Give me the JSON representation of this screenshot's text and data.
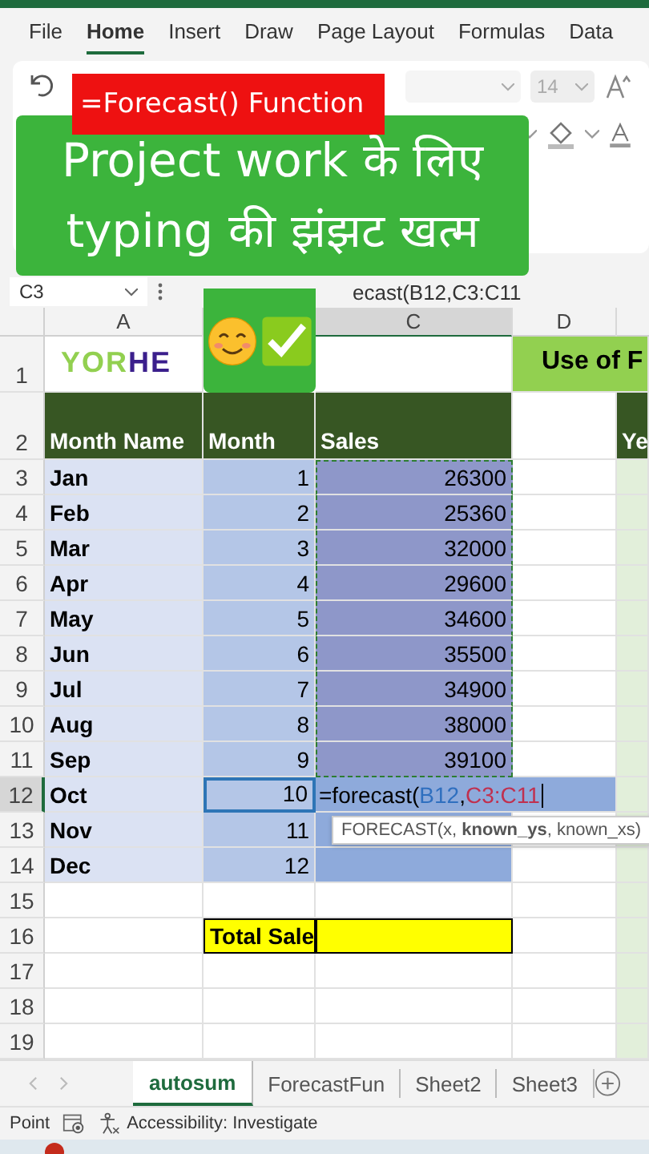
{
  "ribbon": {
    "tabs": [
      {
        "label": "File",
        "selected": false
      },
      {
        "label": "Home",
        "selected": true
      },
      {
        "label": "Insert",
        "selected": false
      },
      {
        "label": "Draw",
        "selected": false
      },
      {
        "label": "Page Layout",
        "selected": false
      },
      {
        "label": "Formulas",
        "selected": false
      },
      {
        "label": "Data",
        "selected": false
      }
    ],
    "font_size": "14"
  },
  "overlays": {
    "caption": "=Forecast() Function",
    "headline": [
      "Project work के लिए",
      "typing की झंझट खत्म"
    ]
  },
  "formula_bar": {
    "name_box": "C3",
    "formula": "ecast(B12,C3:C11"
  },
  "sheet": {
    "columns": [
      {
        "text": "A",
        "selected": false
      },
      {
        "text": "C",
        "selected": true
      },
      {
        "text": "D",
        "selected": false
      }
    ],
    "rows": [
      {
        "num": "1",
        "in_range": false,
        "active": false,
        "cells": [
          {
            "kind": "logo",
            "color": "#ffffff",
            "parts": [
              {
                "text": "YOR",
                "color": "#92d050"
              },
              {
                "text": "HE",
                "color": "#3b1f8c"
              }
            ]
          },
          {
            "kind": "empty",
            "color": "#ffffff"
          },
          {
            "kind": "title",
            "color": "#92d050",
            "text": "Use of F"
          }
        ]
      },
      {
        "num": "2",
        "in_range": false,
        "active": false,
        "cells": [
          {
            "kind": "header",
            "color": "#375623",
            "text": "Month Name"
          },
          {
            "kind": "header",
            "color": "#375623",
            "text": "Month"
          },
          {
            "kind": "header",
            "color": "#375623",
            "text": "Sales"
          },
          {
            "kind": "empty",
            "color": "#ffffff"
          },
          {
            "kind": "header",
            "color": "#375623",
            "text": "Ye"
          }
        ]
      },
      {
        "num": "3",
        "in_range": true,
        "active": false,
        "cells": [
          {
            "kind": "label",
            "color": "#dbe2f3",
            "text": "Jan"
          },
          {
            "kind": "number",
            "color": "#b4c6e7",
            "text": "1"
          },
          {
            "kind": "number",
            "color": "#8e97c9",
            "text": "26300"
          },
          {
            "kind": "empty",
            "color": "#ffffff"
          },
          {
            "kind": "empty",
            "color": "#e2efda"
          }
        ]
      },
      {
        "num": "4",
        "in_range": true,
        "active": false,
        "cells": [
          {
            "kind": "label",
            "color": "#dbe2f3",
            "text": "Feb"
          },
          {
            "kind": "number",
            "color": "#b4c6e7",
            "text": "2"
          },
          {
            "kind": "number",
            "color": "#8e97c9",
            "text": "25360"
          },
          {
            "kind": "empty",
            "color": "#ffffff"
          },
          {
            "kind": "empty",
            "color": "#e2efda"
          }
        ]
      },
      {
        "num": "5",
        "in_range": true,
        "active": false,
        "cells": [
          {
            "kind": "label",
            "color": "#dbe2f3",
            "text": "Mar"
          },
          {
            "kind": "number",
            "color": "#b4c6e7",
            "text": "3"
          },
          {
            "kind": "number",
            "color": "#8e97c9",
            "text": "32000"
          },
          {
            "kind": "empty",
            "color": "#ffffff"
          },
          {
            "kind": "empty",
            "color": "#e2efda"
          }
        ]
      },
      {
        "num": "6",
        "in_range": true,
        "active": false,
        "cells": [
          {
            "kind": "label",
            "color": "#dbe2f3",
            "text": "Apr"
          },
          {
            "kind": "number",
            "color": "#b4c6e7",
            "text": "4"
          },
          {
            "kind": "number",
            "color": "#8e97c9",
            "text": "29600"
          },
          {
            "kind": "empty",
            "color": "#ffffff"
          },
          {
            "kind": "empty",
            "color": "#e2efda"
          }
        ]
      },
      {
        "num": "7",
        "in_range": true,
        "active": false,
        "cells": [
          {
            "kind": "label",
            "color": "#dbe2f3",
            "text": "May"
          },
          {
            "kind": "number",
            "color": "#b4c6e7",
            "text": "5"
          },
          {
            "kind": "number",
            "color": "#8e97c9",
            "text": "34600"
          },
          {
            "kind": "empty",
            "color": "#ffffff"
          },
          {
            "kind": "empty",
            "color": "#e2efda"
          }
        ]
      },
      {
        "num": "8",
        "in_range": true,
        "active": false,
        "cells": [
          {
            "kind": "label",
            "color": "#dbe2f3",
            "text": "Jun"
          },
          {
            "kind": "number",
            "color": "#b4c6e7",
            "text": "6"
          },
          {
            "kind": "number",
            "color": "#8e97c9",
            "text": "35500"
          },
          {
            "kind": "empty",
            "color": "#ffffff"
          },
          {
            "kind": "empty",
            "color": "#e2efda"
          }
        ]
      },
      {
        "num": "9",
        "in_range": true,
        "active": false,
        "cells": [
          {
            "kind": "label",
            "color": "#dbe2f3",
            "text": "Jul"
          },
          {
            "kind": "number",
            "color": "#b4c6e7",
            "text": "7"
          },
          {
            "kind": "number",
            "color": "#8e97c9",
            "text": "34900"
          },
          {
            "kind": "empty",
            "color": "#ffffff"
          },
          {
            "kind": "empty",
            "color": "#e2efda"
          }
        ]
      },
      {
        "num": "10",
        "in_range": true,
        "active": false,
        "cells": [
          {
            "kind": "label",
            "color": "#dbe2f3",
            "text": "Aug"
          },
          {
            "kind": "number",
            "color": "#b4c6e7",
            "text": "8"
          },
          {
            "kind": "number",
            "color": "#8e97c9",
            "text": "38000"
          },
          {
            "kind": "empty",
            "color": "#ffffff"
          },
          {
            "kind": "empty",
            "color": "#e2efda"
          }
        ]
      },
      {
        "num": "11",
        "in_range": true,
        "active": false,
        "cells": [
          {
            "kind": "label",
            "color": "#dbe2f3",
            "text": "Sep"
          },
          {
            "kind": "number",
            "color": "#b4c6e7",
            "text": "9"
          },
          {
            "kind": "number",
            "color": "#8e97c9",
            "text": "39100"
          },
          {
            "kind": "empty",
            "color": "#ffffff"
          },
          {
            "kind": "empty",
            "color": "#e2efda"
          }
        ]
      },
      {
        "num": "12",
        "in_range": false,
        "active": true,
        "cells": [
          {
            "kind": "label",
            "color": "#dbe2f3",
            "text": "Oct"
          },
          {
            "kind": "number",
            "color": "#b4c6e7",
            "text": "10"
          },
          {
            "kind": "formula",
            "color": "#8eaadb",
            "parts": [
              {
                "text": "=forecast(",
                "color": "#000000"
              },
              {
                "text": "B12",
                "color": "#2f6fbf"
              },
              {
                "text": ",",
                "color": "#000000"
              },
              {
                "text": "C3:C11",
                "color": "#c0304f"
              }
            ]
          },
          {
            "kind": "empty",
            "color": "#e2efda"
          }
        ]
      },
      {
        "num": "13",
        "in_range": false,
        "active": false,
        "cells": [
          {
            "kind": "label",
            "color": "#dbe2f3",
            "text": "Nov"
          },
          {
            "kind": "number",
            "color": "#b4c6e7",
            "text": "11"
          },
          {
            "kind": "empty",
            "color": "#8eaadb"
          },
          {
            "kind": "empty",
            "color": "#ffffff"
          },
          {
            "kind": "empty",
            "color": "#e2efda"
          }
        ]
      },
      {
        "num": "14",
        "in_range": false,
        "active": false,
        "cells": [
          {
            "kind": "label",
            "color": "#dbe2f3",
            "text": "Dec"
          },
          {
            "kind": "number",
            "color": "#b4c6e7",
            "text": "12"
          },
          {
            "kind": "empty",
            "color": "#8eaadb"
          },
          {
            "kind": "empty",
            "color": "#ffffff"
          },
          {
            "kind": "empty",
            "color": "#e2efda"
          }
        ]
      },
      {
        "num": "15",
        "in_range": false,
        "active": false,
        "cells": [
          {
            "kind": "empty",
            "color": "#ffffff"
          },
          {
            "kind": "empty",
            "color": "#ffffff"
          },
          {
            "kind": "empty",
            "color": "#ffffff"
          },
          {
            "kind": "empty",
            "color": "#ffffff"
          },
          {
            "kind": "empty",
            "color": "#e2efda"
          }
        ]
      },
      {
        "num": "16",
        "in_range": false,
        "active": false,
        "cells": [
          {
            "kind": "empty",
            "color": "#ffffff"
          },
          {
            "kind": "total",
            "color": "#ffff00",
            "text": "Total Sale"
          },
          {
            "kind": "total",
            "color": "#ffff00"
          },
          {
            "kind": "empty",
            "color": "#ffffff"
          },
          {
            "kind": "empty",
            "color": "#e2efda"
          }
        ]
      },
      {
        "num": "17",
        "in_range": false,
        "active": false,
        "cells": [
          {
            "kind": "empty",
            "color": "#ffffff"
          },
          {
            "kind": "empty",
            "color": "#ffffff"
          },
          {
            "kind": "empty",
            "color": "#ffffff"
          },
          {
            "kind": "empty",
            "color": "#ffffff"
          },
          {
            "kind": "empty",
            "color": "#e2efda"
          }
        ]
      },
      {
        "num": "18",
        "in_range": false,
        "active": false,
        "cells": [
          {
            "kind": "empty",
            "color": "#ffffff"
          },
          {
            "kind": "empty",
            "color": "#ffffff"
          },
          {
            "kind": "empty",
            "color": "#ffffff"
          },
          {
            "kind": "empty",
            "color": "#ffffff"
          },
          {
            "kind": "empty",
            "color": "#e2efda"
          }
        ]
      },
      {
        "num": "19",
        "in_range": false,
        "active": false,
        "cells": [
          {
            "kind": "empty",
            "color": "#ffffff"
          },
          {
            "kind": "empty",
            "color": "#ffffff"
          },
          {
            "kind": "empty",
            "color": "#ffffff"
          },
          {
            "kind": "empty",
            "color": "#ffffff"
          },
          {
            "kind": "empty",
            "color": "#e2efda"
          }
        ]
      }
    ],
    "tooltip": "FORECAST(x, **known_ys**, known_xs)"
  },
  "sheet_tabs": [
    {
      "label": "autosum",
      "selected": true
    },
    {
      "label": "ForecastFun",
      "selected": false
    },
    {
      "label": "Sheet2",
      "selected": false
    },
    {
      "label": "Sheet3",
      "selected": false
    }
  ],
  "status_bar": {
    "mode": "Point",
    "accessibility": "Accessibility: Investigate"
  }
}
